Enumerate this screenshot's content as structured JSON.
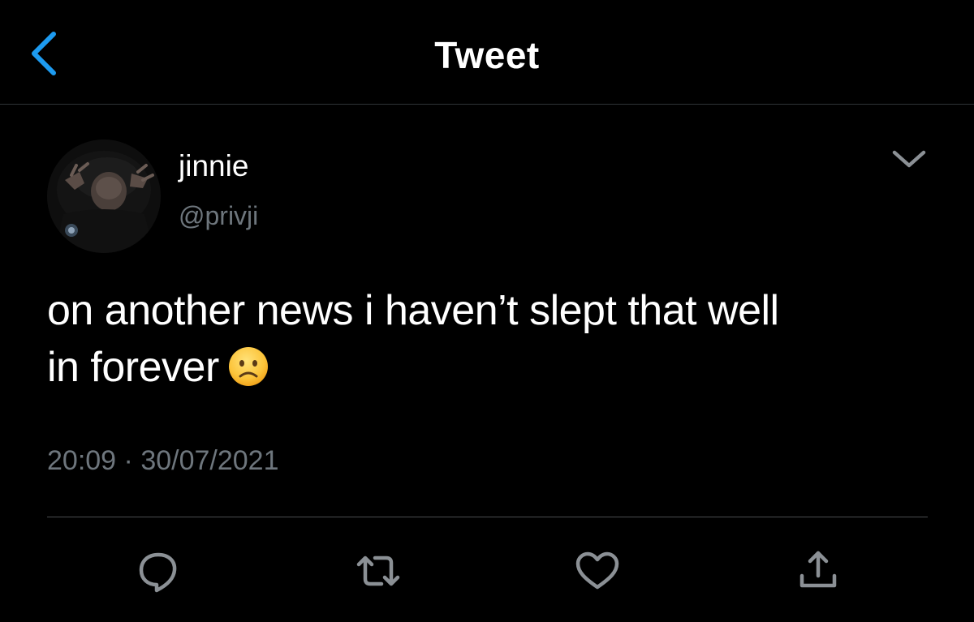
{
  "header": {
    "title": "Tweet",
    "back_icon": "chevron-left-icon",
    "accent_color": "#1d9bf0"
  },
  "tweet": {
    "author": {
      "name": "jinnie",
      "handle": "@privji"
    },
    "menu_icon": "chevron-down-icon",
    "text_line1": "on another news i haven’t slept that well",
    "text_line2": "in forever",
    "emoji": "frowning-face",
    "time": "20:09",
    "separator": "·",
    "date": "30/07/2021"
  },
  "actions": [
    {
      "icon": "reply-icon"
    },
    {
      "icon": "retweet-icon"
    },
    {
      "icon": "like-icon"
    },
    {
      "icon": "share-icon"
    }
  ],
  "colors": {
    "background": "#000000",
    "text": "#ffffff",
    "secondary": "#6e767d",
    "divider": "#2f3336"
  }
}
